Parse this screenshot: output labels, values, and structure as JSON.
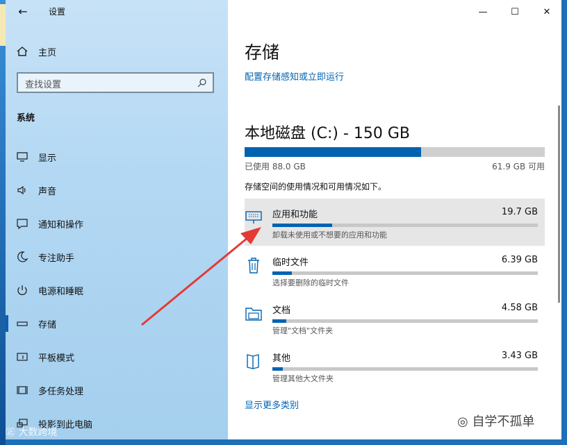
{
  "window": {
    "title": "设置",
    "minimize": "—",
    "maximize": "☐",
    "close": "✕"
  },
  "sidebar": {
    "back": "←",
    "home": "主页",
    "search_placeholder": "查找设置",
    "section": "系统",
    "items": [
      {
        "label": "显示",
        "icon": "monitor-icon"
      },
      {
        "label": "声音",
        "icon": "speaker-icon"
      },
      {
        "label": "通知和操作",
        "icon": "notification-icon"
      },
      {
        "label": "专注助手",
        "icon": "moon-icon"
      },
      {
        "label": "电源和睡眠",
        "icon": "power-icon"
      },
      {
        "label": "存储",
        "icon": "storage-icon",
        "active": true
      },
      {
        "label": "平板模式",
        "icon": "tablet-icon"
      },
      {
        "label": "多任务处理",
        "icon": "multitask-icon"
      },
      {
        "label": "投影到此电脑",
        "icon": "project-icon"
      }
    ]
  },
  "main": {
    "title": "存储",
    "config_link": "配置存储感知或立即运行",
    "disk_title": "本地磁盘 (C:) - 150 GB",
    "used_fraction": 0.587,
    "used_label": "已使用 88.0 GB",
    "avail_label": "61.9 GB 可用",
    "description": "存储空间的使用情况和可用情况如下。",
    "categories": [
      {
        "name": "应用和功能",
        "size": "19.7 GB",
        "sub": "卸载未使用或不想要的应用和功能",
        "fraction": 0.224,
        "icon": "apps-icon"
      },
      {
        "name": "临时文件",
        "size": "6.39 GB",
        "sub": "选择要删除的临时文件",
        "fraction": 0.073,
        "icon": "trash-icon"
      },
      {
        "name": "文档",
        "size": "4.58 GB",
        "sub": "管理\"文档\"文件夹",
        "fraction": 0.052,
        "icon": "folder-icon"
      },
      {
        "name": "其他",
        "size": "3.43 GB",
        "sub": "管理其他大文件夹",
        "fraction": 0.039,
        "icon": "other-icon"
      }
    ],
    "more_link": "显示更多类别"
  },
  "watermarks": {
    "left": "大数跨境",
    "right": "自学不孤单"
  },
  "colors": {
    "accent": "#0063b1",
    "arrow": "#e53935"
  }
}
